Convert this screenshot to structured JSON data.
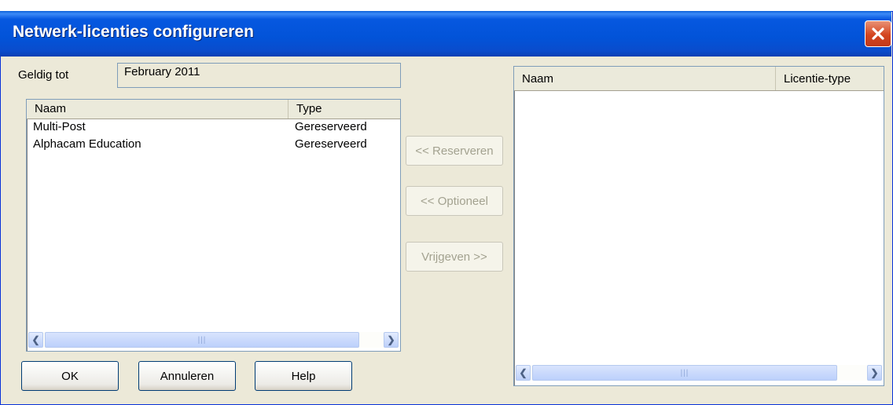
{
  "window": {
    "title": "Netwerk-licenties configureren",
    "close_icon": "close-icon"
  },
  "valid_until": {
    "label": "Geldig tot",
    "value": "February 2011"
  },
  "available_list": {
    "columns": [
      "Naam",
      "Type"
    ],
    "rows": [
      {
        "name": "Multi-Post",
        "type": "Gereserveerd"
      },
      {
        "name": "Alphacam Education",
        "type": "Gereserveerd"
      }
    ],
    "scroll_left_icon": "scroll-left-arrow-icon",
    "scroll_right_icon": "scroll-right-arrow-icon"
  },
  "actions": {
    "reserve_label": "<< Reserveren",
    "optional_label": "<< Optioneel",
    "release_label": "Vrijgeven >>"
  },
  "selected_list": {
    "columns": [
      "Naam",
      "Licentie-type"
    ],
    "rows": []
  },
  "footer": {
    "ok_label": "OK",
    "cancel_label": "Annuleren",
    "help_label": "Help"
  },
  "colors": {
    "title_bar": "#0253d8",
    "dialog_bg": "#ece9d8",
    "close_button": "#d4451f"
  }
}
